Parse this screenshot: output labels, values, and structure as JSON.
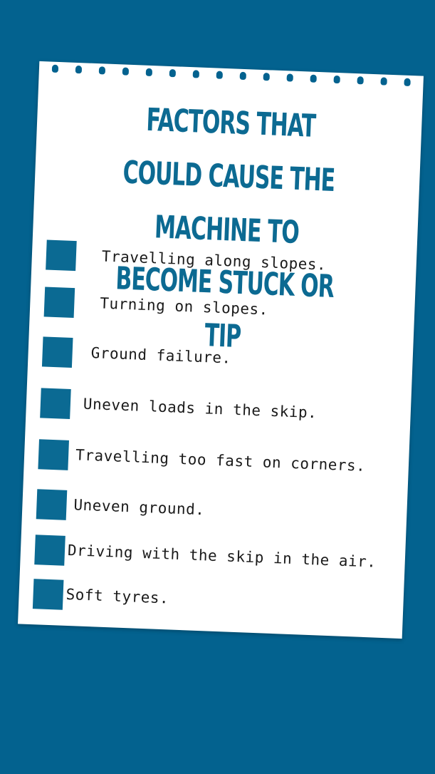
{
  "title": "FACTORS THAT COULD CAUSE THE MACHINE TO BECOME STUCK OR TIP",
  "items": [
    "Travelling along slopes.",
    "Turning on slopes.",
    "Ground failure.",
    "Uneven loads in the skip.",
    "Travelling too fast on corners.",
    "Uneven ground.",
    "Driving with the skip in the air.",
    "Soft tyres."
  ]
}
